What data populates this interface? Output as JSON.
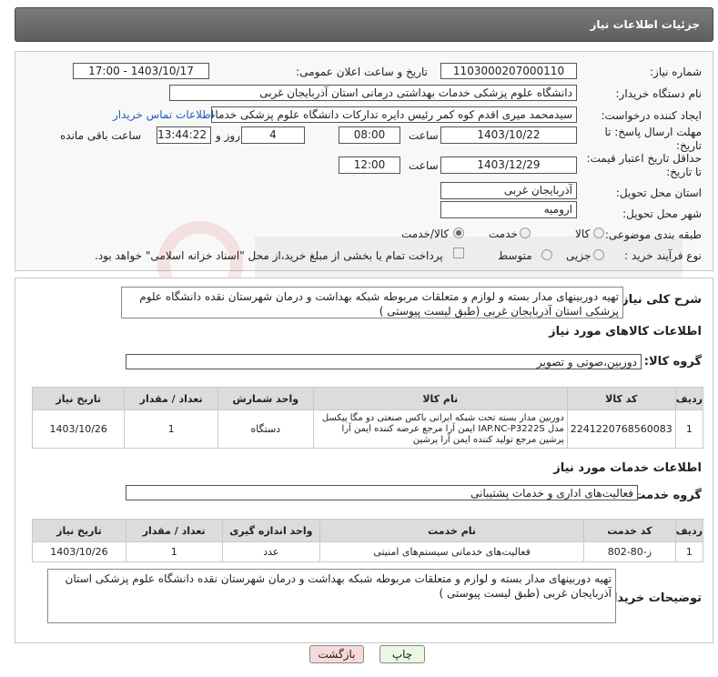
{
  "header": {
    "title": "جزئیات اطلاعات نیاز"
  },
  "form": {
    "need_number_label": "شماره نیاز:",
    "need_number": "1103000207000110",
    "announce_label": "تاریخ و ساعت اعلان عمومی:",
    "announce_value": "1403/10/17 - 17:00",
    "buyer_org_label": "نام دستگاه خریدار:",
    "buyer_org": "دانشگاه علوم پزشکی خدمات بهداشتی درمانی استان آذربایجان غربی",
    "creator_label": "ایجاد کننده درخواست:",
    "creator": "سیدمحمد میری اقدم کوه کمر رئیس دایره تدارکات دانشگاه علوم پزشکی خدمات",
    "contact_link": "اطلاعات تماس خریدار",
    "deadline_label": "مهلت ارسال پاسخ: تا تاریخ:",
    "deadline_date": "1403/10/22",
    "hour_label": "ساعت",
    "deadline_time": "08:00",
    "days_value": "4",
    "days_label": "روز و",
    "remaining_time": "13:44:22",
    "remaining_label": "ساعت باقی مانده",
    "validity_label": "حداقل تاریخ اعتبار قیمت: تا تاریخ:",
    "validity_date": "1403/12/29",
    "validity_hour_label": "ساعت",
    "validity_time": "12:00",
    "province_label": "استان محل تحویل:",
    "province": "آذربایجان غربی",
    "city_label": "شهر محل تحویل:",
    "city": "ارومیه",
    "category_label": "طبقه بندی موضوعی:",
    "category_options": [
      "کالا",
      "خدمت",
      "کالا/خدمت"
    ],
    "process_label": "نوع فرآیند خرید :",
    "process_options": [
      "جزیی",
      "متوسط"
    ],
    "payment_note": "پرداخت تمام یا بخشی از مبلغ خرید،از محل \"اسناد خزانه اسلامی\" خواهد بود."
  },
  "summary": {
    "label": "شرح کلی نیاز:",
    "text": "تهیه  دوربینهای مدار بسته و لوازم و متعلقات مربوطه  شبکه بهداشت و درمان شهرستان نقده دانشگاه علوم پزشکی استان آذربایجان غربی (طبق لیست پیوستی )"
  },
  "goods": {
    "section_title": "اطلاعات کالاهای مورد نیاز",
    "group_label": "گروه کالا:",
    "group_value": "دوربین،صوتی و تصویر",
    "columns": [
      "ردیف",
      "کد کالا",
      "نام کالا",
      "واحد شمارش",
      "تعداد / مقدار",
      "تاریخ نیاز"
    ],
    "rows": [
      {
        "idx": "1",
        "code": "2241220768560083",
        "name": "دوربین مدار بسته تحت شبکه ایرانی باکس صنعتی دو مگا پیکسل مدل IAP.NC-P3222S ایمن آرا مرجع عرضه کننده ایمن آرا پرشین مرجع تولید کننده ایمن آرا پرشین",
        "unit": "دستگاه",
        "qty": "1",
        "date": "1403/10/26"
      }
    ]
  },
  "services": {
    "section_title": "اطلاعات خدمات مورد نیاز",
    "group_label": "گروه خدمت:",
    "group_value": "فعالیت‌های اداری و خدمات پشتیبانی",
    "columns": [
      "ردیف",
      "کد خدمت",
      "نام خدمت",
      "واحد اندازه گیری",
      "تعداد / مقدار",
      "تاریخ نیاز"
    ],
    "rows": [
      {
        "idx": "1",
        "code": "ز-80-802",
        "name": "فعالیت‌های خدماتی سیستم‌های امنیتی",
        "unit": "عدد",
        "qty": "1",
        "date": "1403/10/26"
      }
    ]
  },
  "buyer_notes": {
    "label": "توضیحات خریدار:",
    "text": "تهیه  دوربینهای مدار بسته و لوازم و متعلقات مربوطه  شبکه بهداشت و درمان شهرستان نقده دانشگاه علوم پزشکی استان آذربایجان غربی (طبق لیست پیوستی )"
  },
  "buttons": {
    "print": "چاپ",
    "back": "بازگشت"
  },
  "colors": {
    "header_bg": "#6b6b6b",
    "link": "#1a5fb4",
    "back_btn_bg": "#f7d9d9",
    "table_head": "#dcdcdc"
  }
}
